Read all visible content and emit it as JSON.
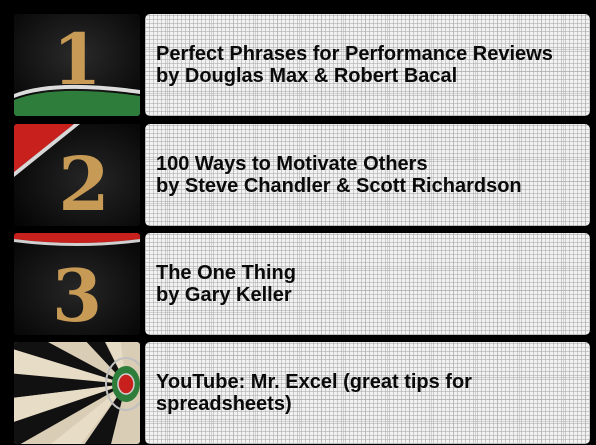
{
  "items": [
    {
      "number": "1",
      "title": "Perfect Phrases for Performance Reviews",
      "author": "by Douglas Max & Robert Bacal"
    },
    {
      "number": "2",
      "title": "100 Ways to Motivate Others",
      "author": "by Steve Chandler & Scott Richardson"
    },
    {
      "number": "3",
      "title": "The One Thing",
      "author": "by Gary Keller"
    },
    {
      "number": "",
      "title": "YouTube:  Mr. Excel (great tips for spreadsheets)",
      "author": ""
    }
  ],
  "colors": {
    "background": "#000000",
    "card": "#f2f2f2",
    "number_gold": "#c79a55",
    "dart_red": "#c8201c",
    "dart_green": "#2e7d3a"
  }
}
